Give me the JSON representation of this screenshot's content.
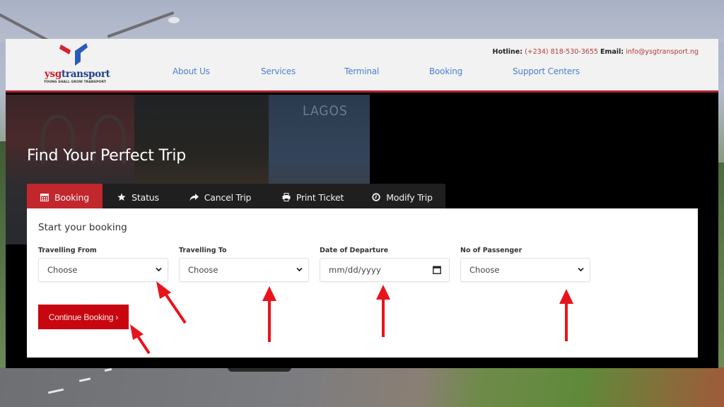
{
  "header": {
    "brand": {
      "name_red": "ysg",
      "name_blue": "transport",
      "tagline": "YOUNG SHALL GROW TRANSPORT"
    },
    "contact": {
      "hotline_label": "Hotline:",
      "hotline_value": "(+234) 818-530-3655",
      "email_label": "Email:",
      "email_value": "info@ysgtransport.ng"
    },
    "nav": [
      {
        "label": "About Us"
      },
      {
        "label": "Services"
      },
      {
        "label": "Terminal"
      },
      {
        "label": "Booking"
      },
      {
        "label": "Support Centers"
      }
    ]
  },
  "hero": {
    "title": "Find Your Perfect Trip",
    "image_caption": "LAGOS"
  },
  "tabs": [
    {
      "label": "Booking",
      "icon": "calendar-icon",
      "active": true
    },
    {
      "label": "Status",
      "icon": "star-icon",
      "active": false
    },
    {
      "label": "Cancel Trip",
      "icon": "share-arrow-icon",
      "active": false
    },
    {
      "label": "Print Ticket",
      "icon": "print-icon",
      "active": false
    },
    {
      "label": "Modify Trip",
      "icon": "clock-icon",
      "active": false
    }
  ],
  "form": {
    "title": "Start your booking",
    "fields": [
      {
        "label": "Travelling From",
        "type": "select",
        "value": "Choose"
      },
      {
        "label": "Travelling To",
        "type": "select",
        "value": "Choose"
      },
      {
        "label": "Date of Departure",
        "type": "date",
        "placeholder": "mm/dd/yyyy"
      },
      {
        "label": "No of Passenger",
        "type": "select",
        "value": "Choose"
      }
    ],
    "submit_label": "Continue Booking ›"
  },
  "colors": {
    "brand_red": "#c1272d",
    "button_red": "#c8060f",
    "nav_blue": "#4a7fd0",
    "annotation_arrow": "#e8141c"
  }
}
